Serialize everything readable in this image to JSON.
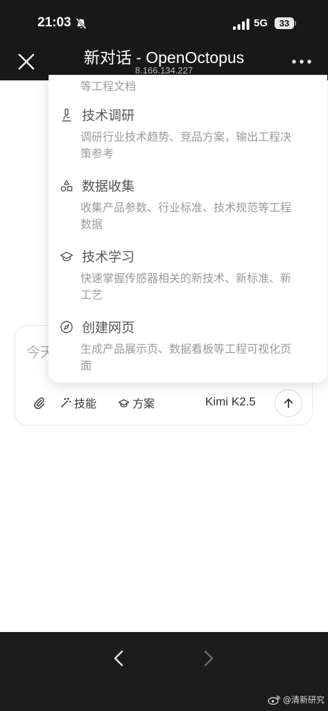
{
  "status_bar": {
    "time": "21:03",
    "network": "5G",
    "battery": "33"
  },
  "header": {
    "title": "新对话 - OpenOctopus",
    "subtitle": "8.166.134.227"
  },
  "skill_menu": {
    "items": [
      {
        "title": "",
        "description": "等工程文档",
        "icon": "document-icon"
      },
      {
        "title": "技术调研",
        "description": "调研行业技术趋势、竞品方案，输出工程决策参考",
        "icon": "microscope-icon"
      },
      {
        "title": "数据收集",
        "description": "收集产品参数、行业标准、技术规范等工程数据",
        "icon": "shapes-icon"
      },
      {
        "title": "技术学习",
        "description": "快速掌握传感器相关的新技术、新标准、新工艺",
        "icon": "graduation-cap-icon"
      },
      {
        "title": "创建网页",
        "description": "生成产品展示页、数据看板等工程可视化页面",
        "icon": "compass-icon"
      }
    ]
  },
  "input": {
    "placeholder": "今天",
    "skill_label": "技能",
    "plan_label": "方案",
    "model": "Kimi K2.5"
  },
  "watermark": "@清新研究",
  "colors": {
    "header_bg": "#181818",
    "bottom_bar_bg": "#1c1c1c",
    "menu_title": "#555555",
    "menu_desc": "#9a9a9a"
  }
}
